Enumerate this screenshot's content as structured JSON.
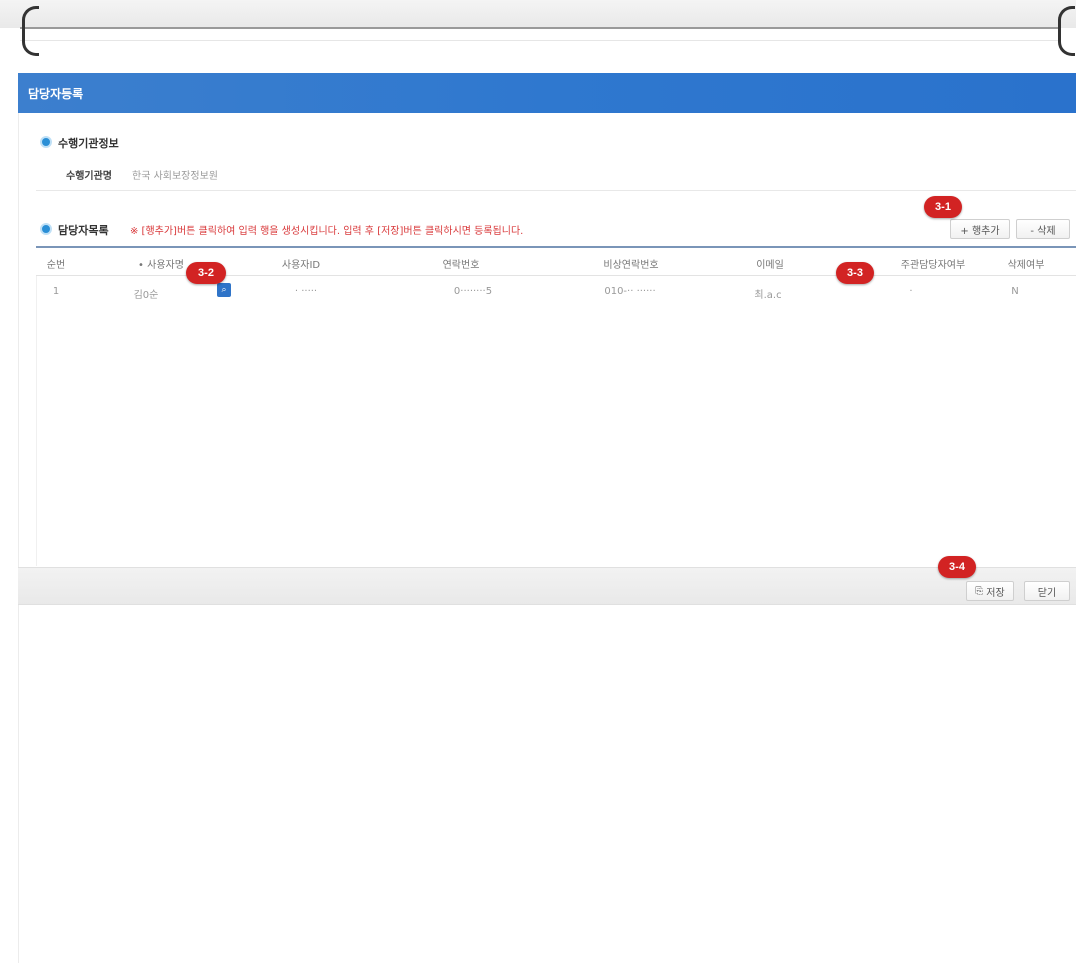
{
  "window": {
    "title": "담당자등록"
  },
  "org_section": {
    "title": "수행기관정보",
    "field_label": "수행기관명",
    "field_value": "한국 사회보장정보원"
  },
  "manager_section": {
    "title": "담당자목록",
    "notice": "※ [행추가]버튼 클릭하여 입력 행을 생성시킵니다. 입력 후 [저장]버튼 클릭하시면 등록됩니다.",
    "add_row_label": "+ 행추가",
    "delete_label": "- 삭제"
  },
  "table": {
    "columns": [
      "순번",
      "• 사용자명",
      "사용자ID",
      "연락번호",
      "비상연락번호",
      "이메일",
      "주관담당자여부",
      "삭제여부"
    ],
    "rows": [
      [
        "1",
        "김0순",
        "·  ·····",
        "0········5",
        "010-·· ······",
        "최.a.c",
        "·",
        "N"
      ]
    ]
  },
  "footer": {
    "save_label": "저장",
    "close_label": "닫기"
  },
  "badges": {
    "b31": "3-1",
    "b32": "3-2",
    "b33": "3-3",
    "b34": "3-4"
  },
  "colors": {
    "title_bar": "#2f78cf",
    "badge": "#d22323",
    "notice": "#d9383a",
    "section_icon": "#2a8fd6"
  }
}
